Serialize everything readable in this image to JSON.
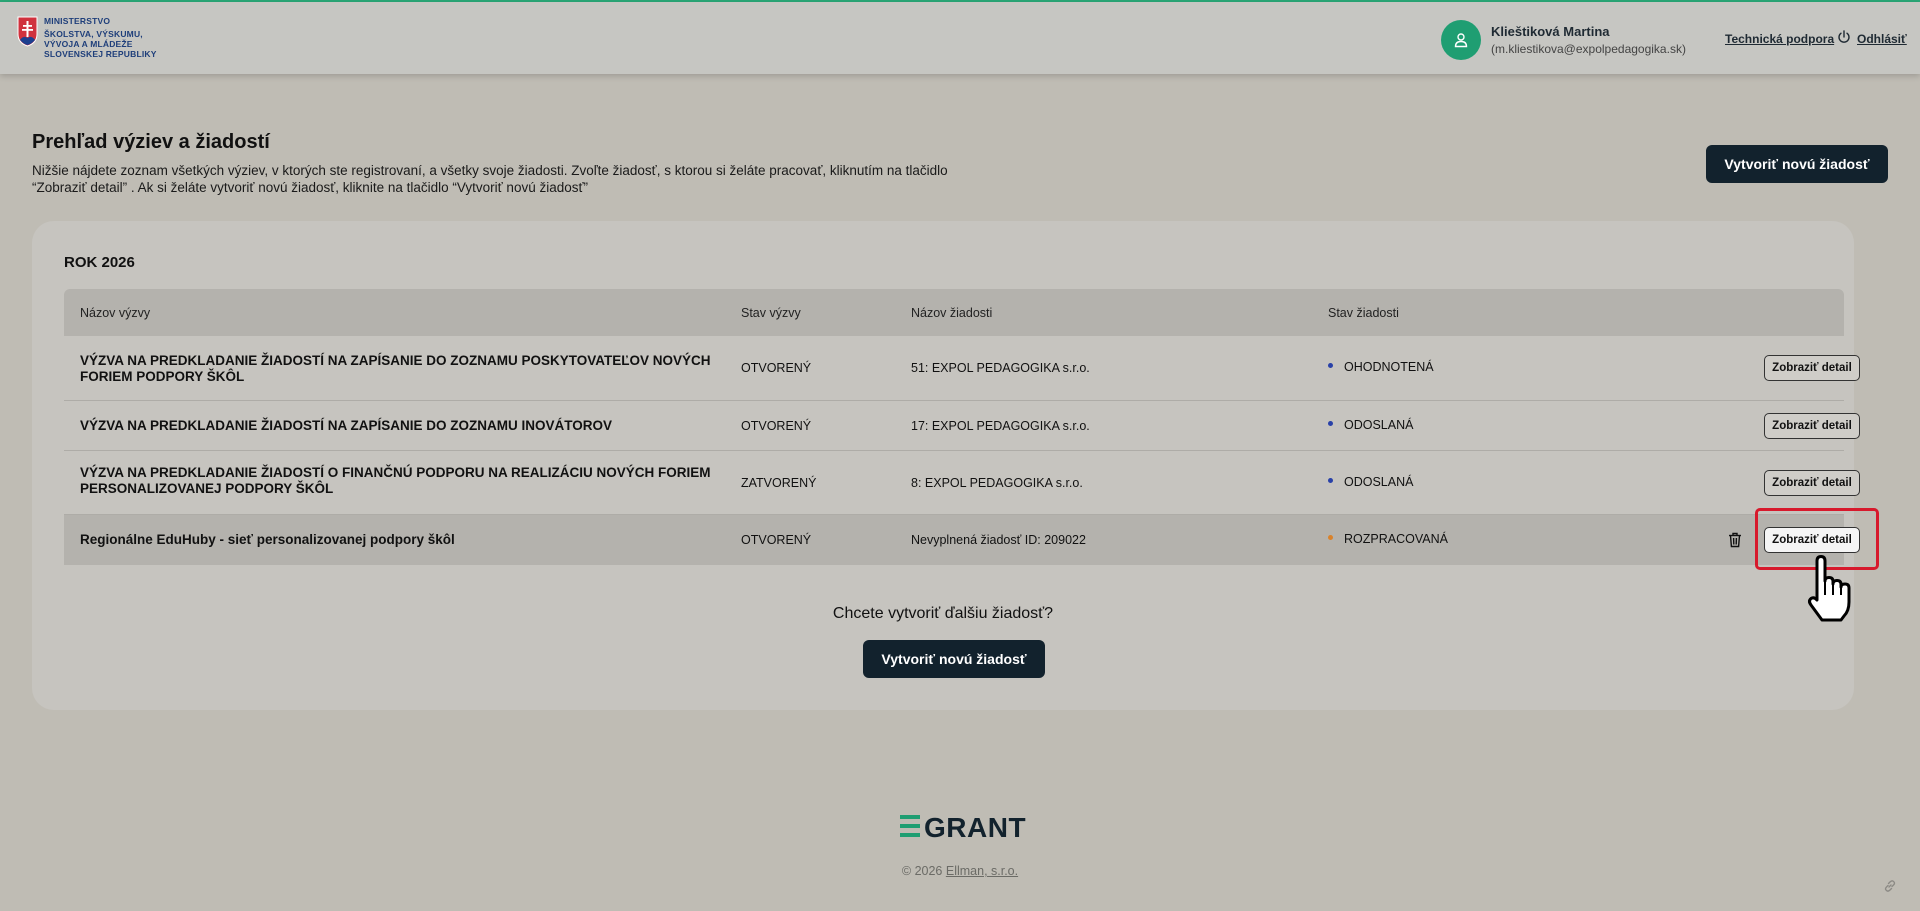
{
  "header": {
    "ministry_lines": [
      "MINISTERSTVO",
      "ŠKOLSTVA, VÝSKUMU,",
      "VÝVOJA A MLÁDEŽE",
      "SLOVENSKEJ REPUBLIKY"
    ],
    "user_name": "Klieštiková Martina",
    "user_email": "(m.kliestikova@expolpedagogika.sk)",
    "support_label": "Technická podpora",
    "logout_label": "Odhlásiť",
    "icons": [
      "crest-icon",
      "user-icon",
      "power-icon"
    ]
  },
  "page": {
    "title": "Prehľad výziev a žiadostí",
    "description": "Nižšie nájdete zoznam všetkých výziev, v ktorých ste registrovaní, a všetky svoje žiadosti. Zvoľte žiadosť, s ktorou si želáte pracovať, kliknutím na tlačidlo “Zobraziť detail” . Ak si želáte vytvoriť novú žiadosť, kliknite na tlačidlo “Vytvoriť novú žiadosť”",
    "new_button": "Vytvoriť novú žiadosť"
  },
  "card": {
    "year": "ROK 2026",
    "columns": [
      "Názov výzvy",
      "Stav výzvy",
      "Názov žiadosti",
      "Stav žiadosti"
    ],
    "rows": [
      {
        "call": "VÝZVA NA PREDKLADANIE ŽIADOSTÍ NA ZAPÍSANIE DO ZOZNAMU POSKYTOVATEĽOV NOVÝCH FORIEM PODPORY ŠKÔL",
        "call_state": "OTVORENÝ",
        "application": "51: EXPOL PEDAGOGIKA s.r.o.",
        "app_state": "OHODNOTENÁ",
        "app_state_color": "#2941a8",
        "action": "Zobraziť detail"
      },
      {
        "call": "VÝZVA NA PREDKLADANIE ŽIADOSTÍ NA ZAPÍSANIE DO ZOZNAMU INOVÁTOROV",
        "call_state": "OTVORENÝ",
        "application": "17: EXPOL PEDAGOGIKA s.r.o.",
        "app_state": "ODOSLANÁ",
        "app_state_color": "#2941a8",
        "action": "Zobraziť detail"
      },
      {
        "call": "VÝZVA NA PREDKLADANIE ŽIADOSTÍ O FINANČNÚ PODPORU NA REALIZÁCIU NOVÝCH FORIEM PERSONALIZOVANEJ PODPORY ŠKÔL",
        "call_state": "ZATVORENÝ",
        "application": "8: EXPOL PEDAGOGIKA s.r.o.",
        "app_state": "ODOSLANÁ",
        "app_state_color": "#2941a8",
        "action": "Zobraziť detail"
      },
      {
        "call": "Regionálne EduHuby - sieť personalizovanej podpory škôl",
        "call_state": "OTVORENÝ",
        "application": "Nevyplnená žiadosť ID: 209022",
        "app_state": "ROZPRACOVANÁ",
        "app_state_color": "#d9822b",
        "action": "Zobraziť detail"
      }
    ],
    "more_question": "Chcete vytvoriť ďalšiu žiadosť?",
    "new_button": "Vytvoriť novú žiadosť"
  },
  "footer": {
    "brand": "GRANT",
    "copyright_prefix": "© 2026 ",
    "copyright_link": "Ellman, s.r.o."
  }
}
